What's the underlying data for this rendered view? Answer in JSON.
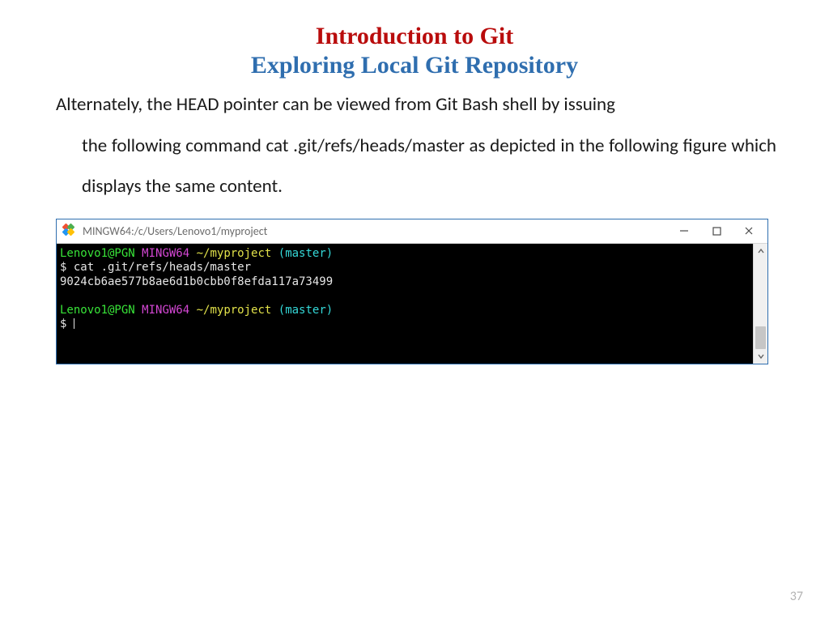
{
  "header": {
    "title_main": "Introduction to Git",
    "title_sub": "Exploring Local Git Repository"
  },
  "body": {
    "line1": "Alternately,  the HEAD pointer can be viewed from Git Bash shell by issuing",
    "rest": "the following command cat .git/refs/heads/master as depicted in the following figure which displays the same content."
  },
  "terminal": {
    "window_title": "MINGW64:/c/Users/Lenovo1/myproject",
    "prompt": {
      "user": "Lenovo1@PGN",
      "host": "MINGW64",
      "path": "~/myproject",
      "branch": "(master)"
    },
    "command": "$ cat .git/refs/heads/master",
    "output": "9024cb6ae577b8ae6d1b0cbb0f8efda117a73499",
    "prompt2_dollar": "$ "
  },
  "page_number": "37"
}
